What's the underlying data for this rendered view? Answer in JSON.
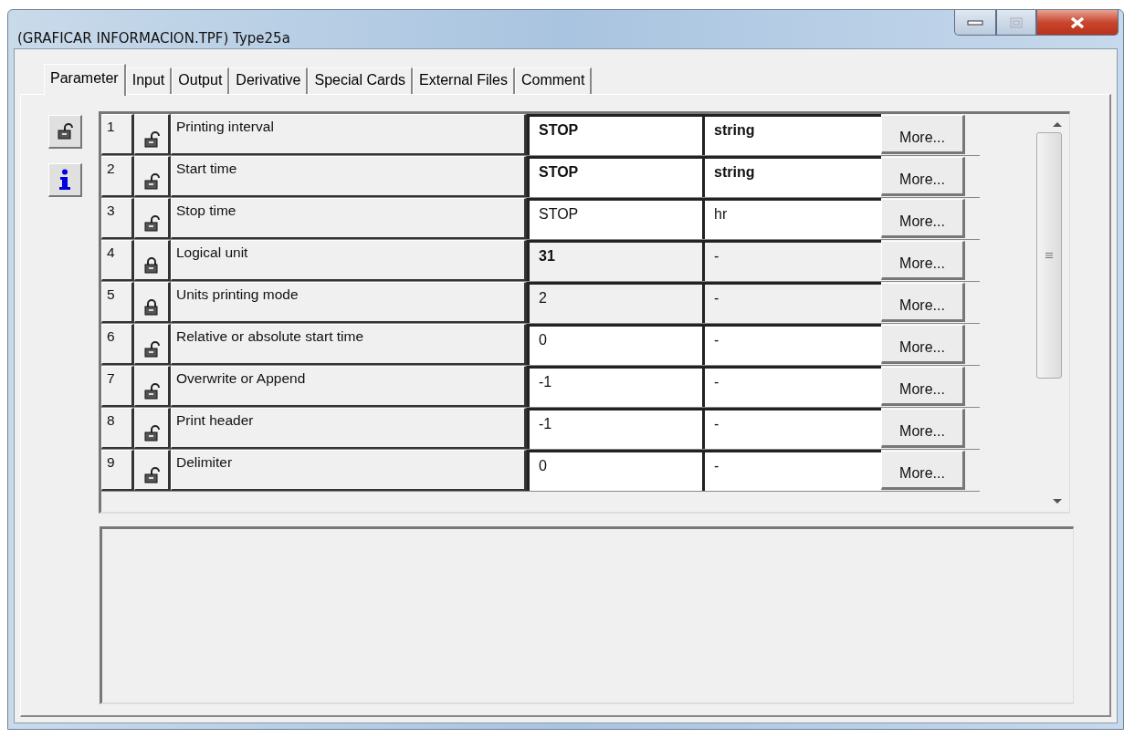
{
  "window": {
    "title": "(GRAFICAR INFORMACION.TPF) Type25a"
  },
  "tabs": [
    {
      "label": "Parameter",
      "selected": true
    },
    {
      "label": "Input",
      "selected": false
    },
    {
      "label": "Output",
      "selected": false
    },
    {
      "label": "Derivative",
      "selected": false
    },
    {
      "label": "Special Cards",
      "selected": false
    },
    {
      "label": "External Files",
      "selected": false
    },
    {
      "label": "Comment",
      "selected": false
    }
  ],
  "rows": [
    {
      "number": "1",
      "locked": false,
      "name": "Printing interval",
      "value": "STOP",
      "value_bold": true,
      "unit": "string",
      "unit_bold": true,
      "button": "More..."
    },
    {
      "number": "2",
      "locked": false,
      "name": "Start time",
      "value": "STOP",
      "value_bold": true,
      "unit": "string",
      "unit_bold": true,
      "button": "More..."
    },
    {
      "number": "3",
      "locked": false,
      "name": "Stop time",
      "value": "STOP",
      "value_bold": false,
      "unit": "hr",
      "unit_bold": false,
      "button": "More..."
    },
    {
      "number": "4",
      "locked": true,
      "name": "Logical unit",
      "value": "31",
      "value_bold": true,
      "unit": "-",
      "unit_bold": false,
      "button": "More..."
    },
    {
      "number": "5",
      "locked": true,
      "name": "Units printing mode",
      "value": "2",
      "value_bold": false,
      "unit": "-",
      "unit_bold": false,
      "button": "More..."
    },
    {
      "number": "6",
      "locked": false,
      "name": "Relative or absolute start time",
      "value": "0",
      "value_bold": false,
      "unit": "-",
      "unit_bold": false,
      "button": "More..."
    },
    {
      "number": "7",
      "locked": false,
      "name": "Overwrite or Append",
      "value": "-1",
      "value_bold": false,
      "unit": "-",
      "unit_bold": false,
      "button": "More..."
    },
    {
      "number": "8",
      "locked": false,
      "name": "Print header",
      "value": "-1",
      "value_bold": false,
      "unit": "-",
      "unit_bold": false,
      "button": "More..."
    },
    {
      "number": "9",
      "locked": false,
      "name": "Delimiter",
      "value": "0",
      "value_bold": false,
      "unit": "-",
      "unit_bold": false,
      "button": "More..."
    }
  ]
}
